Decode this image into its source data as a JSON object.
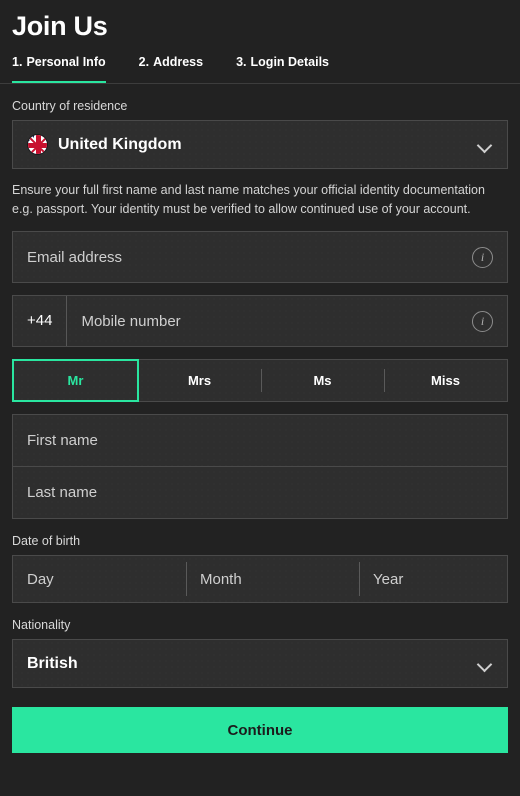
{
  "header": {
    "title": "Join Us"
  },
  "tabs": [
    {
      "number": "1.",
      "label": "Personal Info",
      "active": true
    },
    {
      "number": "2.",
      "label": "Address",
      "active": false
    },
    {
      "number": "3.",
      "label": "Login Details",
      "active": false
    }
  ],
  "country": {
    "label": "Country of residence",
    "value": "United Kingdom",
    "flag_icon": "uk-flag-icon",
    "chevron_icon": "chevron-down-icon"
  },
  "disclaimer": {
    "text": "Ensure your full first name and last name matches your official identity documentation e.g. passport. Your identity must be verified to allow continued use of your account."
  },
  "email": {
    "placeholder": "Email address",
    "value": "",
    "info_icon": "info-icon"
  },
  "mobile": {
    "dial_code": "+44",
    "placeholder": "Mobile number",
    "value": "",
    "info_icon": "info-icon"
  },
  "title_options": [
    {
      "label": "Mr",
      "selected": true
    },
    {
      "label": "Mrs",
      "selected": false
    },
    {
      "label": "Ms",
      "selected": false
    },
    {
      "label": "Miss",
      "selected": false
    }
  ],
  "first_name": {
    "placeholder": "First name",
    "value": ""
  },
  "last_name": {
    "placeholder": "Last name",
    "value": ""
  },
  "date_of_birth": {
    "label": "Date of birth",
    "day_placeholder": "Day",
    "month_placeholder": "Month",
    "year_placeholder": "Year",
    "day_value": "",
    "month_value": "",
    "year_value": ""
  },
  "nationality": {
    "label": "Nationality",
    "value": "British",
    "chevron_icon": "chevron-down-icon"
  },
  "submit": {
    "label": "Continue"
  },
  "colors": {
    "accent_green": "#2ae6a0",
    "page_background": "#222222",
    "field_background": "#2e2e2e",
    "field_border": "#4a4a4a",
    "text_primary": "#ffffff",
    "text_secondary": "#cfcfcf",
    "button_text": "#1c1c1c"
  }
}
